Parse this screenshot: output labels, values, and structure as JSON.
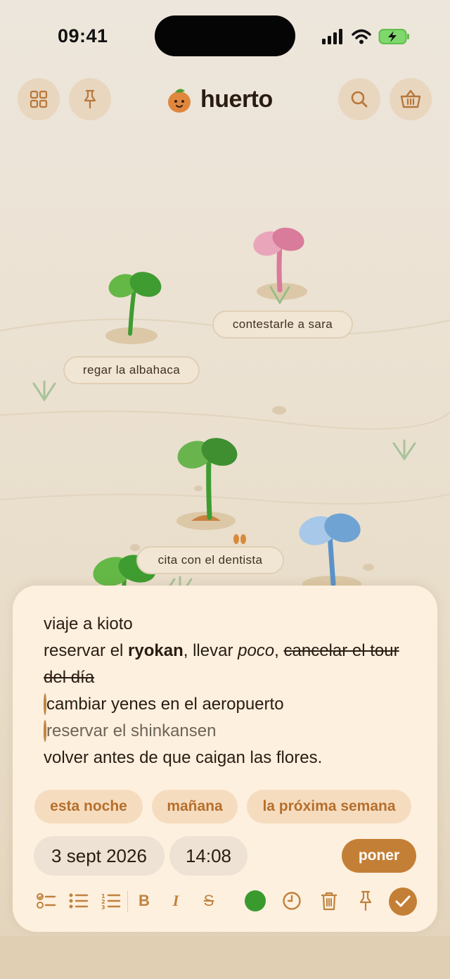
{
  "status": {
    "time": "09:41"
  },
  "header": {
    "title": "huerto",
    "left_buttons": [
      "grid-icon",
      "pin-icon"
    ],
    "right_buttons": [
      "search-icon",
      "basket-icon"
    ]
  },
  "garden": {
    "plants": [
      {
        "label": "contestarle a sara",
        "color": "#d97b9a"
      },
      {
        "label": "regar la albahaca",
        "color": "#3f9c31"
      },
      {
        "label": "cita con el dentista",
        "color": "#3f9c31"
      },
      {
        "label": "",
        "color": "#6fa3d3"
      }
    ]
  },
  "note": {
    "title": "viaje a kioto",
    "line2": {
      "part1": "reservar el ",
      "bold": "ryokan",
      "part2": ", llevar ",
      "italic": "poco",
      "part3": ", ",
      "strike": "cancelar el tour del día"
    },
    "tasks": [
      {
        "text": "cambiar yenes en el aeropuerto",
        "done": false
      },
      {
        "text": "reservar el shinkansen",
        "done": true
      }
    ],
    "last_line": "volver antes de que caigan las flores."
  },
  "reminder": {
    "chips": [
      "esta noche",
      "mañana",
      "la próxima semana"
    ],
    "date": "3 sept 2026",
    "time": "14:08",
    "set_label": "poner"
  },
  "toolbar": {
    "tools": [
      "checklist-icon",
      "bullet-list-icon",
      "numbered-list-icon",
      "bold-icon",
      "italic-icon",
      "strikethrough-icon",
      "color-dot-icon",
      "clock-icon",
      "trash-icon",
      "pin-icon",
      "check-icon"
    ],
    "bold_glyph": "B",
    "italic_glyph": "I",
    "strike_glyph": "S",
    "selected_color": "#3a9a2e",
    "accent": "#c47f36"
  }
}
